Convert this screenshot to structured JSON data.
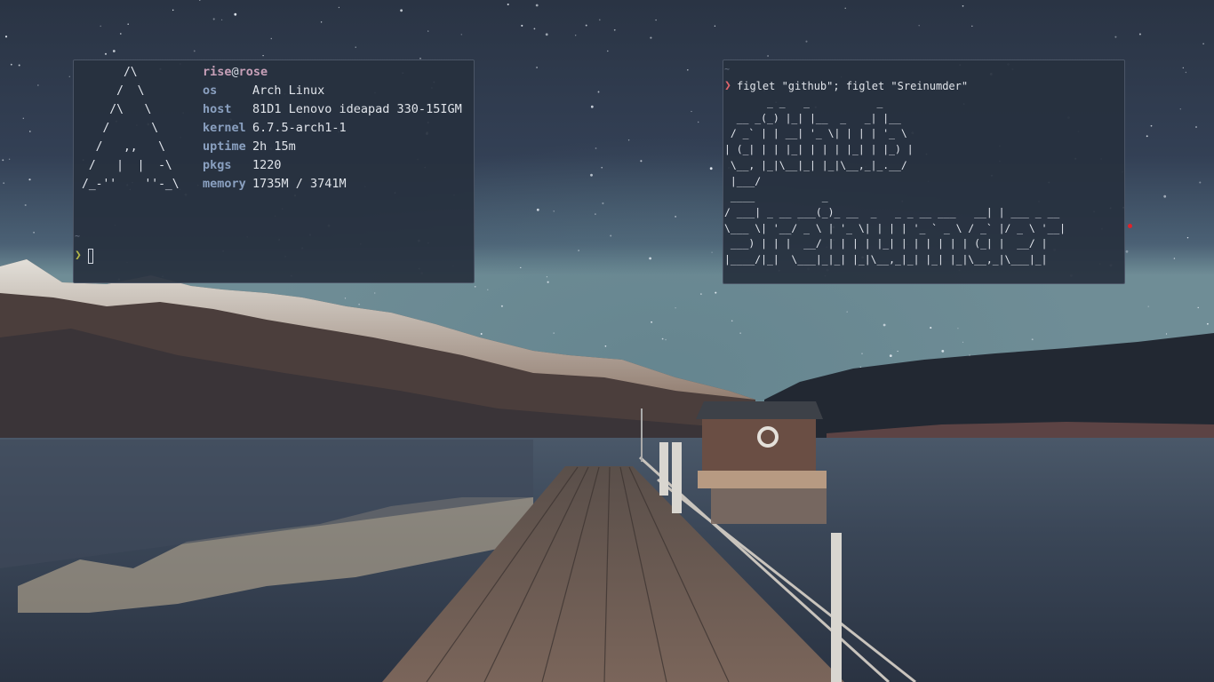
{
  "fetch": {
    "logo_lines": [
      "      /\\",
      "     /  \\",
      "    /\\   \\",
      "   /      \\",
      "  /   ,,   \\",
      " /   |  |  -\\",
      "/_-''    ''-_\\"
    ],
    "user": "rise",
    "at": "@",
    "host_name": "rose",
    "rows": [
      {
        "key": "os",
        "value": "Arch Linux"
      },
      {
        "key": "host",
        "value": "81D1 Lenovo ideapad 330-15IGM"
      },
      {
        "key": "kernel",
        "value": "6.7.5-arch1-1"
      },
      {
        "key": "uptime",
        "value": "2h 15m"
      },
      {
        "key": "pkgs",
        "value": "1220"
      },
      {
        "key": "memory",
        "value": "1735M / 3741M"
      }
    ]
  },
  "left_terminal": {
    "cwd": "~",
    "prompt_symbol": "❯"
  },
  "right_terminal": {
    "cwd": "~",
    "prompt_symbol": "❯",
    "command": "figlet \"github\"; figlet \"Sreinumder\"",
    "figlet_lines": [
      "       _ _   _           _",
      "  __ _(_) |_| |__  _   _| |__",
      " / _` | | __| '_ \\| | | | '_ \\",
      "| (_| | | |_| | | | |_| | |_) |",
      " \\__, |_|\\__|_| |_|\\__,_|_.__/",
      " |___/",
      " ____           _",
      "/ ___| _ __ ___(_)_ __  _   _ _ __ ___   __| | ___ _ __",
      "\\___ \\| '__/ _ \\ | '_ \\| | | | '_ ` _ \\ / _` |/ _ \\ '__|",
      " ___) | | |  __/ | | | | |_| | | | | | | (_| |  __/ |",
      "|____/|_|  \\___|_|_| |_|\\__,_|_| |_| |_|\\__,_|\\___|_|"
    ]
  },
  "colors": {
    "terminal_bg": "#27303e",
    "terminal_border": "#4b5566",
    "user": "#c7a0b8",
    "key": "#8aa0c0",
    "prompt_ok": "#b3b64a",
    "prompt_err": "#e0656c",
    "tray_dot": "#e0222a"
  },
  "wallpaper": {
    "subject": "night-sky-lake-pier"
  }
}
